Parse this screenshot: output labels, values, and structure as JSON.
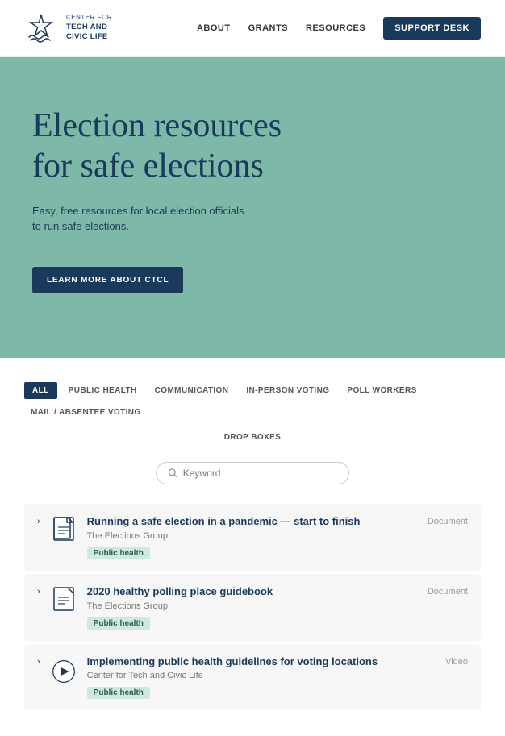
{
  "header": {
    "logo_line1": "CENTER FOR",
    "logo_line2": "TECH AND",
    "logo_line3": "CIVIC LIFE",
    "nav": {
      "about": "ABOUT",
      "grants": "GRANTS",
      "resources": "RESOURCES",
      "support_desk": "SUPPORT DESK"
    }
  },
  "hero": {
    "title": "Election resources for safe elections",
    "subtitle": "Easy, free resources for local election officials to run safe elections.",
    "cta_button": "LEARN MORE ABOUT CTCL"
  },
  "filters": {
    "tabs": [
      {
        "label": "ALL",
        "active": true
      },
      {
        "label": "PUBLIC HEALTH",
        "active": false
      },
      {
        "label": "COMMUNICATION",
        "active": false
      },
      {
        "label": "IN-PERSON VOTING",
        "active": false
      },
      {
        "label": "POLL WORKERS",
        "active": false
      },
      {
        "label": "MAIL / ABSENTEE VOTING",
        "active": false
      }
    ],
    "row2": [
      {
        "label": "DROP BOXES",
        "active": false
      }
    ],
    "search_placeholder": "Keyword"
  },
  "resources": [
    {
      "title": "Running a safe election in a pandemic — start to finish",
      "source": "The Elections Group",
      "tag": "Public health",
      "type": "Document",
      "icon": "document"
    },
    {
      "title": "2020 healthy polling place guidebook",
      "source": "The Elections Group",
      "tag": "Public health",
      "type": "Document",
      "icon": "document"
    },
    {
      "title": "Implementing public health guidelines for voting locations",
      "source": "Center for Tech and Civic Life",
      "tag": "Public health",
      "type": "Video",
      "icon": "video"
    }
  ],
  "colors": {
    "hero_bg": "#7eb8a8",
    "dark_blue": "#1a3a5c",
    "tag_bg": "#d0e8e2",
    "tag_text": "#2a6050"
  }
}
